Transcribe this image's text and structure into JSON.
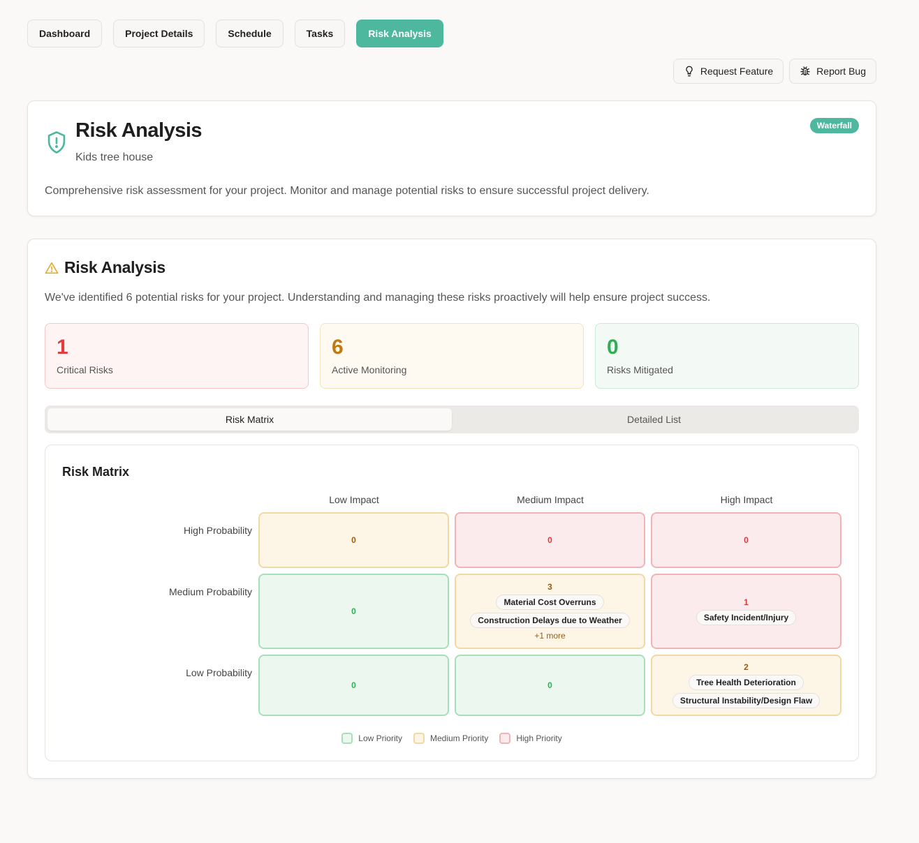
{
  "nav": {
    "items": [
      "Dashboard",
      "Project Details",
      "Schedule",
      "Tasks",
      "Risk Analysis"
    ],
    "active": "Risk Analysis"
  },
  "actions": {
    "request_feature": "Request Feature",
    "report_bug": "Report Bug"
  },
  "header": {
    "title": "Risk Analysis",
    "project": "Kids tree house",
    "badge": "Waterfall",
    "description": "Comprehensive risk assessment for your project. Monitor and manage potential risks to ensure successful project delivery."
  },
  "analysis": {
    "title": "Risk Analysis",
    "description": "We've identified 6 potential risks for your project. Understanding and managing these risks proactively will help ensure project success.",
    "stats": [
      {
        "value": "1",
        "label": "Critical Risks",
        "tone": "red"
      },
      {
        "value": "6",
        "label": "Active Monitoring",
        "tone": "amber"
      },
      {
        "value": "0",
        "label": "Risks Mitigated",
        "tone": "green"
      }
    ]
  },
  "tabs": {
    "matrix": "Risk Matrix",
    "list": "Detailed List",
    "active": "matrix"
  },
  "matrix": {
    "title": "Risk Matrix",
    "columns": [
      "Low Impact",
      "Medium Impact",
      "High Impact"
    ],
    "rows": [
      "High Probability",
      "Medium Probability",
      "Low Probability"
    ],
    "cells": [
      [
        {
          "count": "0",
          "level": "medium",
          "risks": []
        },
        {
          "count": "0",
          "level": "high",
          "risks": []
        },
        {
          "count": "0",
          "level": "high",
          "risks": []
        }
      ],
      [
        {
          "count": "0",
          "level": "low",
          "risks": []
        },
        {
          "count": "3",
          "level": "medium",
          "risks": [
            "Material Cost Overruns",
            "Construction Delays due to Weather"
          ],
          "more": "+1 more"
        },
        {
          "count": "1",
          "level": "high",
          "risks": [
            "Safety Incident/Injury"
          ]
        }
      ],
      [
        {
          "count": "0",
          "level": "low",
          "risks": []
        },
        {
          "count": "0",
          "level": "low",
          "risks": []
        },
        {
          "count": "2",
          "level": "medium",
          "risks": [
            "Tree Health Deterioration",
            "Structural Instability/Design Flaw"
          ]
        }
      ]
    ],
    "legend": [
      "Low Priority",
      "Medium Priority",
      "High Priority"
    ]
  },
  "colors": {
    "accent": "#4db89e",
    "low": "#a8dfbb",
    "medium": "#f1d9a5",
    "high": "#f1b4b6"
  }
}
